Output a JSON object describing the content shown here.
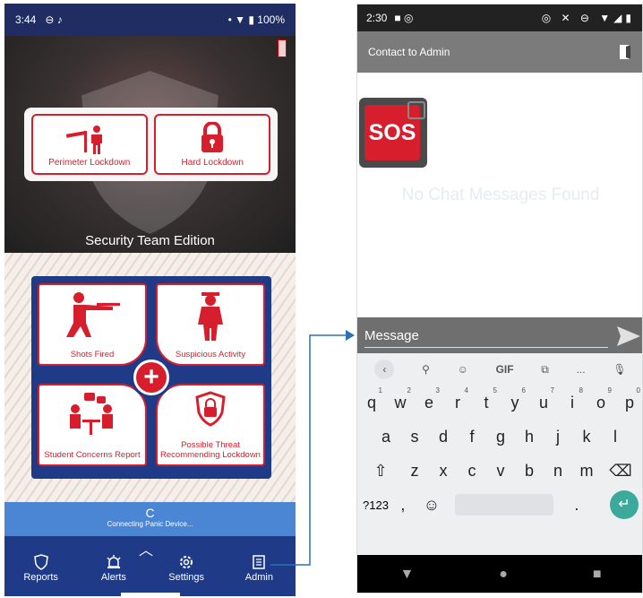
{
  "left_phone": {
    "status": {
      "time": "3:44",
      "battery": "100%"
    },
    "lock_buttons": [
      {
        "label": "Perimeter Lockdown"
      },
      {
        "label": "Hard Lockdown"
      }
    ],
    "edition_label": "Security Team Edition",
    "tiles": [
      {
        "label": "Shots Fired"
      },
      {
        "label": "Suspicious Activity"
      },
      {
        "label": "Student Concerns Report"
      },
      {
        "label": "Possible Threat Recommending Lockdown"
      }
    ],
    "panic_status": "Connecting Panic Device...",
    "nav": [
      {
        "label": "Reports",
        "icon": "shield-icon"
      },
      {
        "label": "Alerts",
        "icon": "alarm-icon"
      },
      {
        "label": "Settings",
        "icon": "gear-icon"
      },
      {
        "label": "Admin",
        "icon": "admin-icon"
      }
    ]
  },
  "right_phone": {
    "status": {
      "time": "2:30"
    },
    "appbar_title": "Contact to Admin",
    "sos_label": "SOS",
    "empty_message": "No Chat Messages Found",
    "message_placeholder": "Message",
    "keyboard": {
      "toolbar": [
        "GIF",
        "..."
      ],
      "row1": [
        "q",
        "w",
        "e",
        "r",
        "t",
        "y",
        "u",
        "i",
        "o",
        "p"
      ],
      "row1_hints": [
        "1",
        "2",
        "3",
        "4",
        "5",
        "6",
        "7",
        "8",
        "9",
        "0"
      ],
      "row2": [
        "a",
        "s",
        "d",
        "f",
        "g",
        "h",
        "j",
        "k",
        "l"
      ],
      "row3": [
        "z",
        "x",
        "c",
        "v",
        "b",
        "n",
        "m"
      ],
      "mode_key": "?123",
      "comma": ",",
      "period": "."
    }
  },
  "colors": {
    "brand_red": "#d61e2c",
    "brand_blue": "#1f3a86",
    "panic_blue": "#4a86d4"
  }
}
